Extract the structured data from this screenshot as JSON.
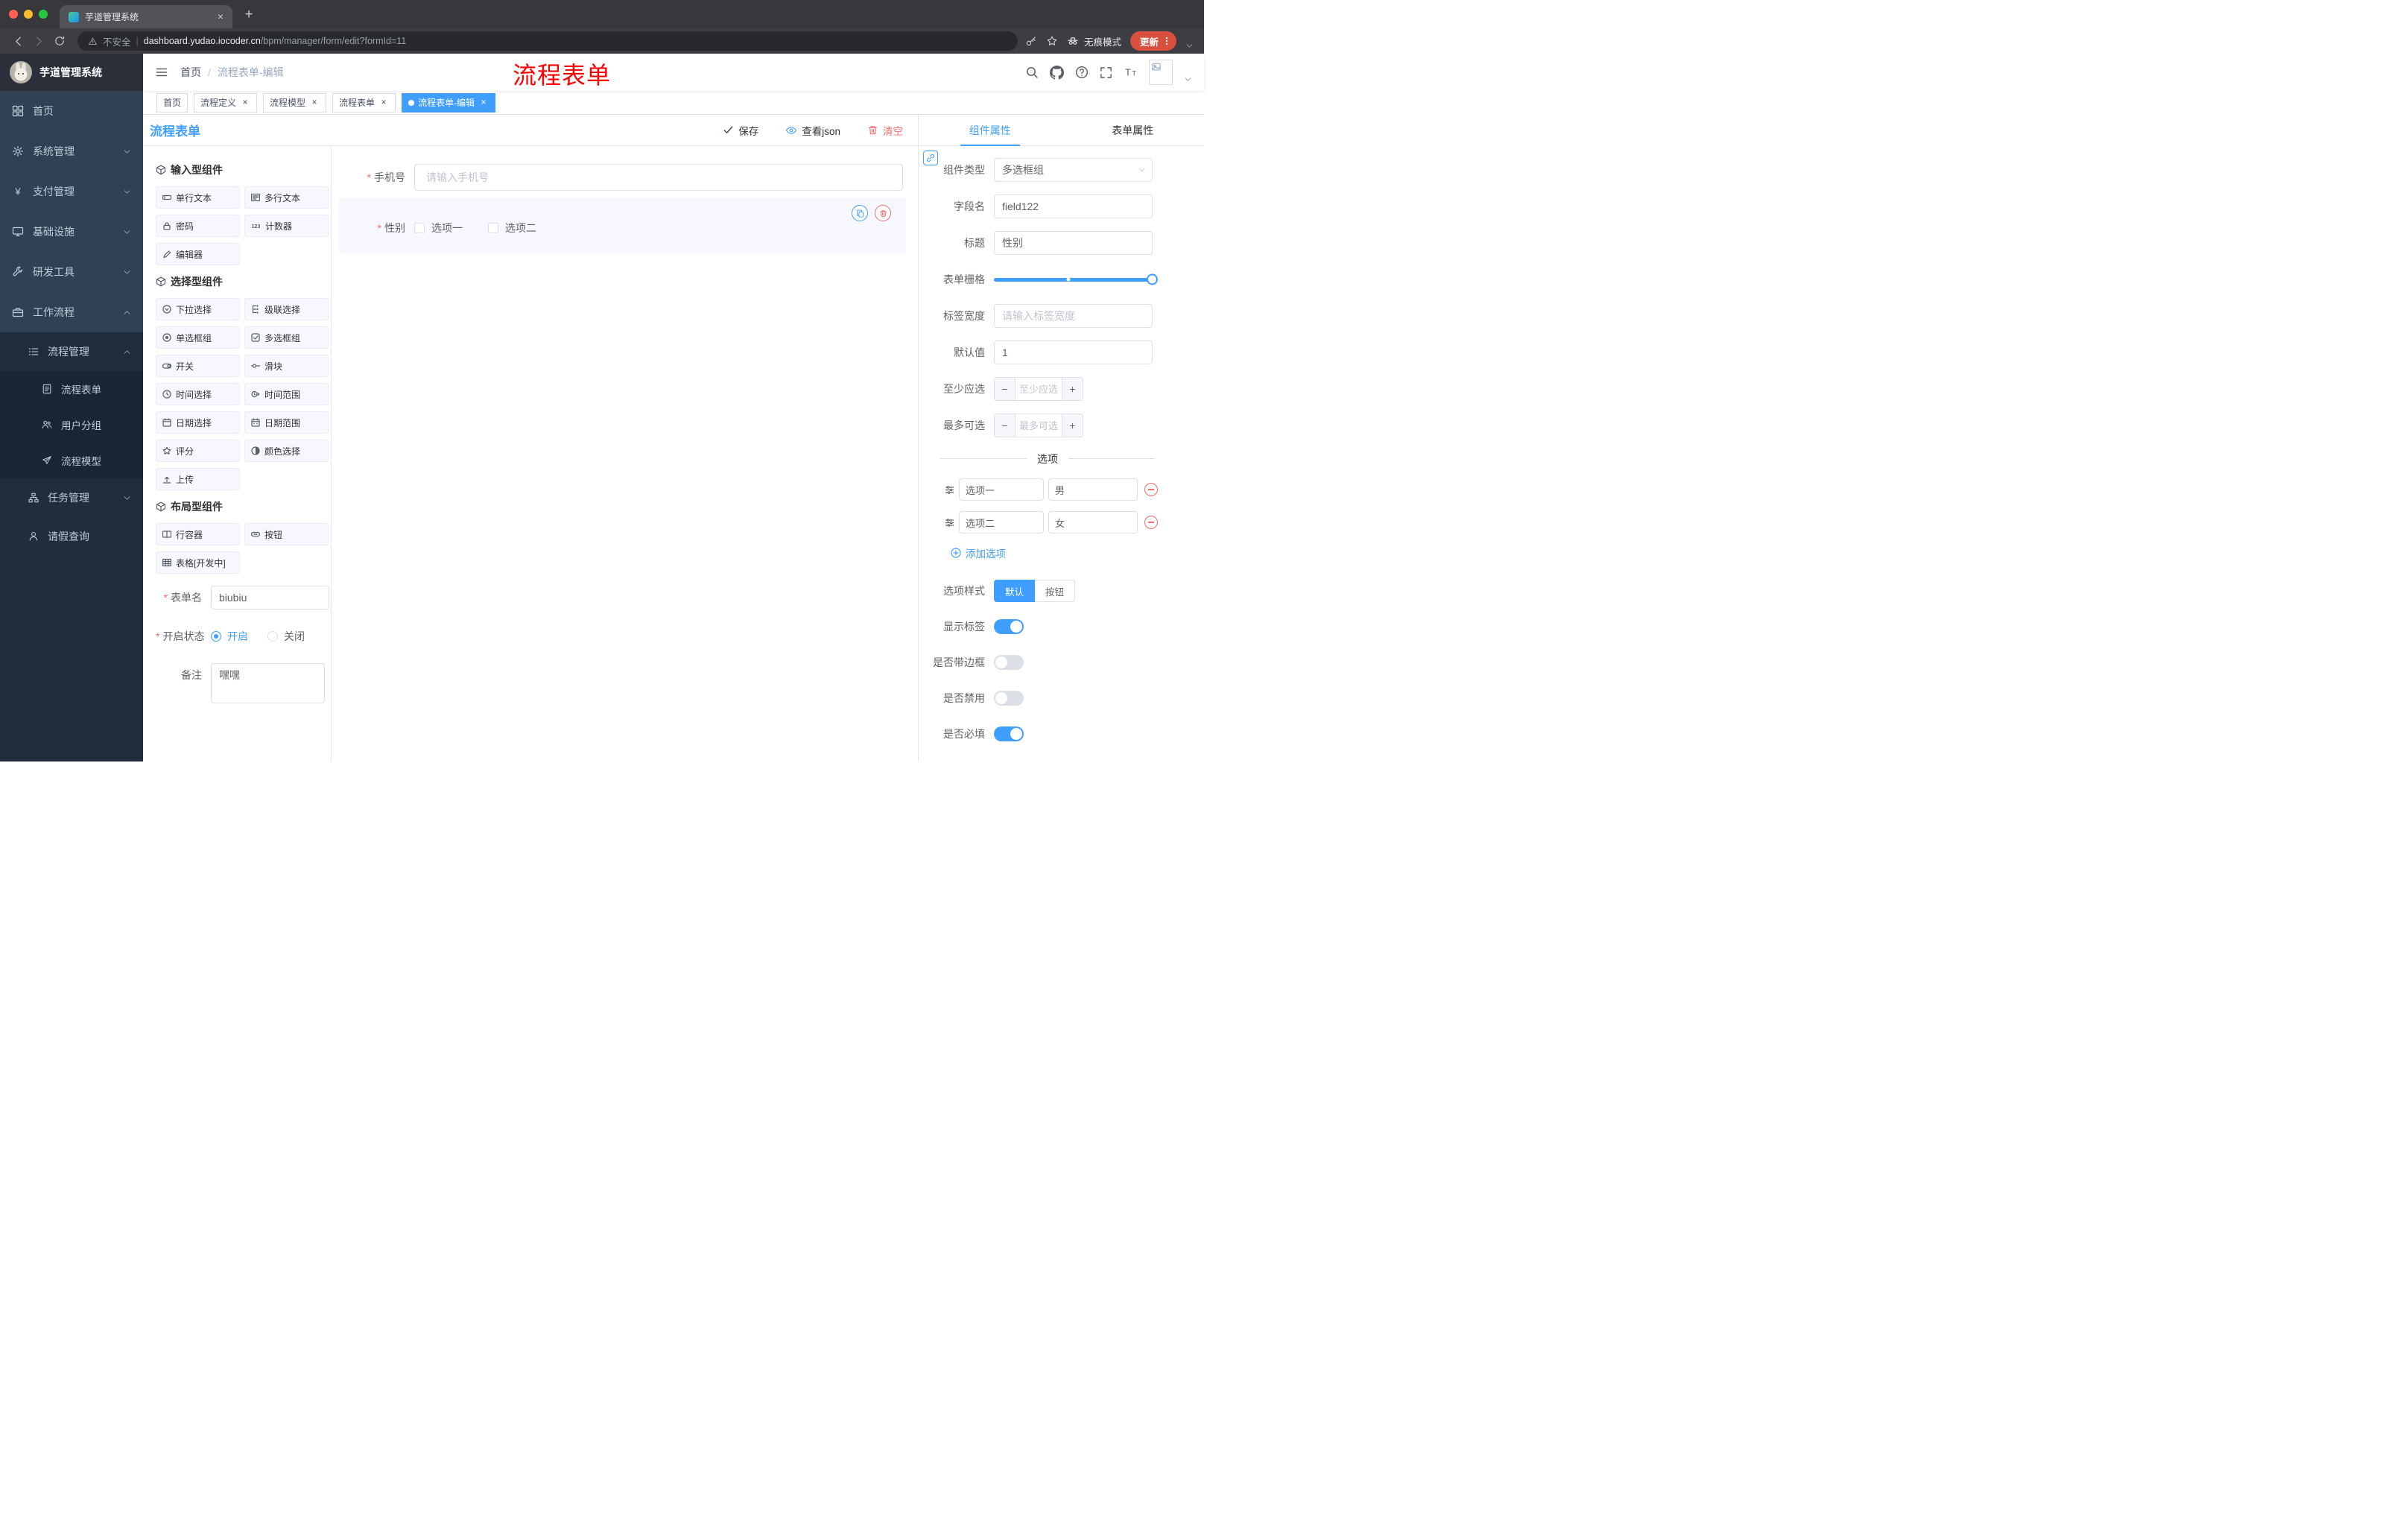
{
  "browser": {
    "tab_title": "芋道管理系统",
    "security_label": "不安全",
    "url_host": "dashboard.yudao.iocoder.cn",
    "url_path": "/bpm/manager/form/edit?formId=11",
    "incognito_label": "无痕模式",
    "update_label": "更新"
  },
  "annotation": {
    "text": "流程表单"
  },
  "colors": {
    "primary": "#409eff",
    "danger": "#f56c6c",
    "sidebar_bg": "#304156",
    "annotation": "#ff0000",
    "active_tag_bg": "#409eff"
  },
  "sidebar": {
    "logo_text": "芋道管理系统",
    "items": [
      {
        "label": "首页",
        "icon": "dashboard-icon"
      },
      {
        "label": "系统管理",
        "icon": "gear-icon"
      },
      {
        "label": "支付管理",
        "icon": "yen-icon"
      },
      {
        "label": "基础设施",
        "icon": "monitor-icon"
      },
      {
        "label": "研发工具",
        "icon": "wrench-icon"
      },
      {
        "label": "工作流程",
        "icon": "briefcase-icon"
      },
      {
        "label": "流程管理",
        "icon": "list-icon"
      },
      {
        "label": "流程表单",
        "icon": "document-icon"
      },
      {
        "label": "用户分组",
        "icon": "users-icon"
      },
      {
        "label": "流程模型",
        "icon": "send-icon"
      },
      {
        "label": "任务管理",
        "icon": "tree-icon"
      },
      {
        "label": "请假查询",
        "icon": "user-icon"
      }
    ]
  },
  "navbar": {
    "breadcrumb_home": "首页",
    "breadcrumb_sep": "/",
    "breadcrumb_current": "流程表单-编辑"
  },
  "tags": [
    {
      "label": "首页"
    },
    {
      "label": "流程定义"
    },
    {
      "label": "流程模型"
    },
    {
      "label": "流程表单"
    },
    {
      "label": "流程表单-编辑"
    }
  ],
  "designer": {
    "title": "流程表单",
    "save_label": "保存",
    "view_json_label": "查看json",
    "clear_label": "清空",
    "groups": [
      {
        "title": "输入型组件",
        "items": [
          {
            "label": "单行文本",
            "icon": "single-line-text-icon"
          },
          {
            "label": "多行文本",
            "icon": "multi-line-text-icon"
          },
          {
            "label": "密码",
            "icon": "password-lock-icon"
          },
          {
            "label": "计数器",
            "icon": "counter-icon"
          },
          {
            "label": "编辑器",
            "icon": "editor-pencil-icon"
          }
        ]
      },
      {
        "title": "选择型组件",
        "items": [
          {
            "label": "下拉选择",
            "icon": "select-dropdown-icon"
          },
          {
            "label": "级联选择",
            "icon": "cascader-icon"
          },
          {
            "label": "单选框组",
            "icon": "radio-group-icon"
          },
          {
            "label": "多选框组",
            "icon": "checkbox-group-icon"
          },
          {
            "label": "开关",
            "icon": "switch-icon"
          },
          {
            "label": "滑块",
            "icon": "slider-icon"
          },
          {
            "label": "时间选择",
            "icon": "time-picker-icon"
          },
          {
            "label": "时间范围",
            "icon": "time-range-icon"
          },
          {
            "label": "日期选择",
            "icon": "date-picker-icon"
          },
          {
            "label": "日期范围",
            "icon": "date-range-icon"
          },
          {
            "label": "评分",
            "icon": "rate-star-icon"
          },
          {
            "label": "颜色选择",
            "icon": "color-picker-icon"
          },
          {
            "label": "上传",
            "icon": "upload-icon"
          }
        ]
      },
      {
        "title": "布局型组件",
        "items": [
          {
            "label": "行容器",
            "icon": "row-container-icon"
          },
          {
            "label": "按钮",
            "icon": "button-icon"
          },
          {
            "label": "表格[开发中]",
            "icon": "table-icon"
          }
        ]
      }
    ],
    "meta": {
      "name_label": "表单名",
      "name_value": "biubiu",
      "status_label": "开启状态",
      "status_on": "开启",
      "status_off": "关闭",
      "remark_label": "备注",
      "remark_value": "嘿嘿"
    },
    "canvas": {
      "phone_label": "手机号",
      "phone_placeholder": "请输入手机号",
      "gender_label": "性别",
      "gender_option1": "选项一",
      "gender_option2": "选项二"
    }
  },
  "props": {
    "tab_component": "组件属性",
    "tab_form": "表单属性",
    "component_type_label": "组件类型",
    "component_type_value": "多选框组",
    "field_name_label": "字段名",
    "field_name_value": "field122",
    "title_label": "标题",
    "title_value": "性别",
    "grid_label": "表单栅格",
    "label_width_label": "标签宽度",
    "label_width_placeholder": "请输入标签宽度",
    "default_label": "默认值",
    "default_value": "1",
    "min_label": "至少应选",
    "min_placeholder": "至少应选",
    "max_label": "最多可选",
    "max_placeholder": "最多可选",
    "options_divider": "选项",
    "options": [
      {
        "label": "选项一",
        "value": "男"
      },
      {
        "label": "选项二",
        "value": "女"
      }
    ],
    "add_option_label": "添加选项",
    "option_style_label": "选项样式",
    "style_default": "默认",
    "style_button": "按钮",
    "toggles": [
      {
        "label": "显示标签",
        "on": true
      },
      {
        "label": "是否带边框",
        "on": false
      },
      {
        "label": "是否禁用",
        "on": false
      },
      {
        "label": "是否必填",
        "on": true
      }
    ]
  }
}
